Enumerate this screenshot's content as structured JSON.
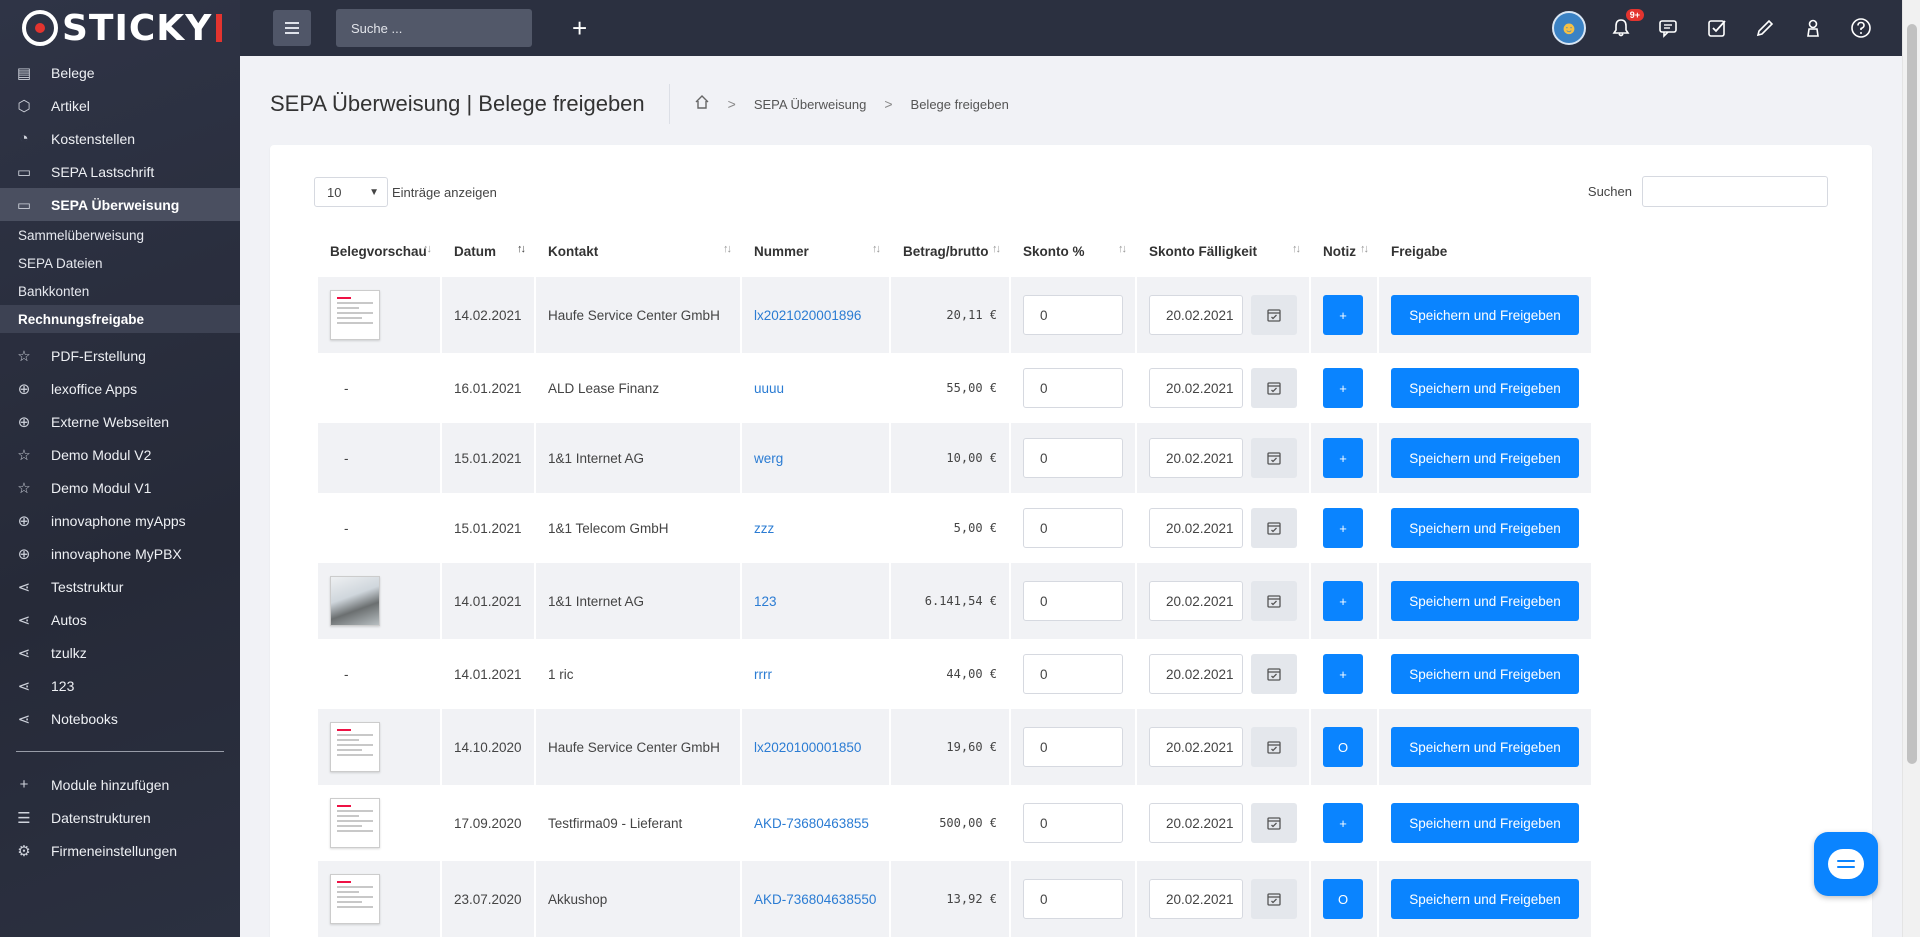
{
  "brand": {
    "name": "STICKY"
  },
  "sidebar": {
    "items": [
      {
        "label": "Belege",
        "icon": "document-icon"
      },
      {
        "label": "Artikel",
        "icon": "box-icon"
      },
      {
        "label": "Kostenstellen",
        "icon": "pie-chart-icon"
      },
      {
        "label": "SEPA Lastschrift",
        "icon": "card-icon"
      },
      {
        "label": "SEPA Überweisung",
        "icon": "card-icon",
        "active": true
      }
    ],
    "subitems": [
      {
        "label": "Sammelüberweisung"
      },
      {
        "label": "SEPA Dateien"
      },
      {
        "label": "Bankkonten"
      },
      {
        "label": "Rechnungsfreigabe",
        "active": true
      }
    ],
    "items2": [
      {
        "label": "PDF-Erstellung",
        "icon": "star-icon"
      },
      {
        "label": "lexoffice Apps",
        "icon": "globe-icon"
      },
      {
        "label": "Externe Webseiten",
        "icon": "globe-icon"
      },
      {
        "label": "Demo Modul V2",
        "icon": "star-icon"
      },
      {
        "label": "Demo Modul V1",
        "icon": "star-icon"
      },
      {
        "label": "innovaphone myApps",
        "icon": "globe-icon"
      },
      {
        "label": "innovaphone MyPBX",
        "icon": "globe-icon"
      },
      {
        "label": "Teststruktur",
        "icon": "share-icon"
      },
      {
        "label": "Autos",
        "icon": "share-icon"
      },
      {
        "label": "tzulkz",
        "icon": "share-icon"
      },
      {
        "label": "123",
        "icon": "share-icon"
      },
      {
        "label": "Notebooks",
        "icon": "share-icon"
      }
    ],
    "items3": [
      {
        "label": "Module hinzufügen",
        "icon": "plus-icon"
      },
      {
        "label": "Datenstrukturen",
        "icon": "database-icon"
      },
      {
        "label": "Firmeneinstellungen",
        "icon": "gear-icon"
      }
    ]
  },
  "topbar": {
    "search_placeholder": "Suche ...",
    "notification_badge": "9+"
  },
  "page": {
    "title": "SEPA Überweisung | Belege freigeben",
    "breadcrumb": [
      "SEPA Überweisung",
      "Belege freigeben"
    ]
  },
  "table_controls": {
    "page_length": "10",
    "length_label": "Einträge anzeigen",
    "search_label": "Suchen"
  },
  "table": {
    "columns": [
      "Belegvorschau",
      "Datum",
      "Kontakt",
      "Nummer",
      "Betrag/brutto",
      "Skonto %",
      "Skonto Fälligkeit",
      "Notiz",
      "Freigabe"
    ],
    "rows": [
      {
        "preview": "doc",
        "date": "14.02.2021",
        "contact": "Haufe Service Center GmbH",
        "number": "lx2021020001896",
        "amount": "20,11 €",
        "skonto": "0",
        "due": "20.02.2021",
        "note": "+",
        "action": "Speichern und Freigeben"
      },
      {
        "preview": "-",
        "date": "16.01.2021",
        "contact": "ALD Lease Finanz",
        "number": "uuuu",
        "amount": "55,00 €",
        "skonto": "0",
        "due": "20.02.2021",
        "note": "+",
        "action": "Speichern und Freigeben"
      },
      {
        "preview": "-",
        "date": "15.01.2021",
        "contact": "1&1 Internet AG",
        "number": "werg",
        "amount": "10,00 €",
        "skonto": "0",
        "due": "20.02.2021",
        "note": "+",
        "action": "Speichern und Freigeben"
      },
      {
        "preview": "-",
        "date": "15.01.2021",
        "contact": "1&1 Telecom GmbH",
        "number": "zzz",
        "amount": "5,00 €",
        "skonto": "0",
        "due": "20.02.2021",
        "note": "+",
        "action": "Speichern und Freigeben"
      },
      {
        "preview": "photo",
        "date": "14.01.2021",
        "contact": "1&1 Internet AG",
        "number": "123",
        "amount": "6.141,54 €",
        "skonto": "0",
        "due": "20.02.2021",
        "note": "+",
        "action": "Speichern und Freigeben"
      },
      {
        "preview": "-",
        "date": "14.01.2021",
        "contact": "1 ric",
        "number": "rrrr",
        "amount": "44,00 €",
        "skonto": "0",
        "due": "20.02.2021",
        "note": "+",
        "action": "Speichern und Freigeben"
      },
      {
        "preview": "doc",
        "date": "14.10.2020",
        "contact": "Haufe Service Center GmbH",
        "number": "lx2020100001850",
        "amount": "19,60 €",
        "skonto": "0",
        "due": "20.02.2021",
        "note": "O",
        "action": "Speichern und Freigeben"
      },
      {
        "preview": "doc",
        "date": "17.09.2020",
        "contact": "Testfirma09 - Lieferant",
        "number": "AKD-73680463855",
        "amount": "500,00 €",
        "skonto": "0",
        "due": "20.02.2021",
        "note": "+",
        "action": "Speichern und Freigeben"
      },
      {
        "preview": "doc",
        "date": "23.07.2020",
        "contact": "Akkushop",
        "number": "AKD-736804638550",
        "amount": "13,92 €",
        "skonto": "0",
        "due": "20.02.2021",
        "note": "O",
        "action": "Speichern und Freigeben"
      }
    ]
  }
}
